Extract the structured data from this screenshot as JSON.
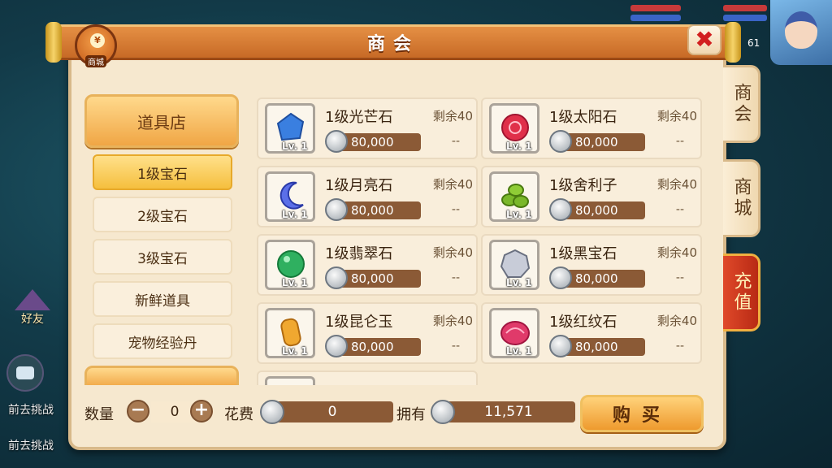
{
  "title": "商会",
  "shop_badge_label": "商城",
  "side_tabs": [
    "商会",
    "商城",
    "充值"
  ],
  "categories": {
    "header": "道具店",
    "items": [
      "1级宝石",
      "2级宝石",
      "3级宝石",
      "新鲜道具",
      "宠物经验丹"
    ]
  },
  "items": [
    {
      "name": "1级光芒石",
      "remain": "剩余40",
      "price": "80,000",
      "level": "Lv. 1",
      "limit": "--",
      "color": "#3a7fe0"
    },
    {
      "name": "1级太阳石",
      "remain": "剩余40",
      "price": "80,000",
      "level": "Lv. 1",
      "limit": "--",
      "color": "#e0304a"
    },
    {
      "name": "1级月亮石",
      "remain": "剩余40",
      "price": "80,000",
      "level": "Lv. 1",
      "limit": "--",
      "color": "#5b6fe8"
    },
    {
      "name": "1级舍利子",
      "remain": "剩余40",
      "price": "80,000",
      "level": "Lv. 1",
      "limit": "--",
      "color": "#7ab82a"
    },
    {
      "name": "1级翡翠石",
      "remain": "剩余40",
      "price": "80,000",
      "level": "Lv. 1",
      "limit": "--",
      "color": "#2fb060"
    },
    {
      "name": "1级黑宝石",
      "remain": "剩余40",
      "price": "80,000",
      "level": "Lv. 1",
      "limit": "--",
      "color": "#8e94a8"
    },
    {
      "name": "1级昆仑玉",
      "remain": "剩余40",
      "price": "80,000",
      "level": "Lv. 1",
      "limit": "--",
      "color": "#f0a830"
    },
    {
      "name": "1级红纹石",
      "remain": "剩余40",
      "price": "80,000",
      "level": "Lv. 1",
      "limit": "--",
      "color": "#e03a6a"
    }
  ],
  "bottom": {
    "qty_label": "数量",
    "qty_value": "0",
    "minus": "−",
    "plus": "+",
    "cost_label": "花费",
    "cost_value": "0",
    "own_label": "拥有",
    "own_value": "11,571",
    "buy_label": "购买"
  },
  "background": {
    "friend_label": "好友",
    "msg1": "前去挑战",
    "msg2": "前去挑战",
    "level": "61"
  }
}
